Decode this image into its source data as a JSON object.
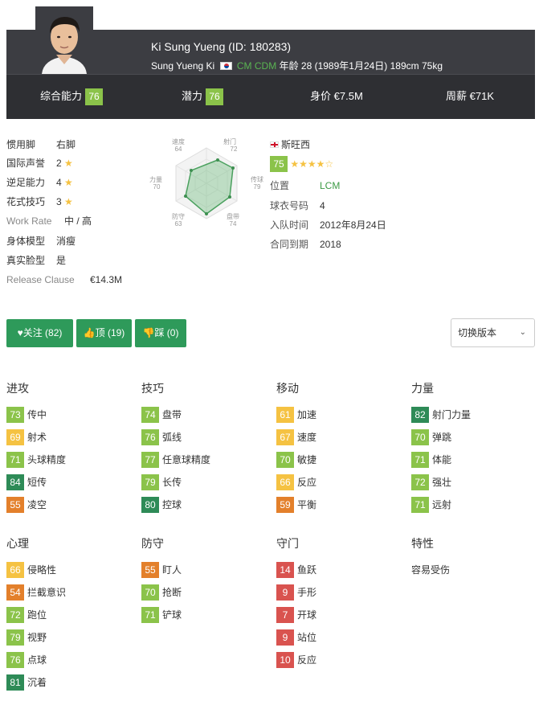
{
  "header": {
    "name": "Ki Sung Yueng (ID: 180283)",
    "short_name": "Sung Yueng Ki",
    "positions": [
      "CM",
      "CDM"
    ],
    "bio": "年龄 28 (1989年1月24日) 189cm 75kg",
    "overall_label": "综合能力",
    "overall_value": "76",
    "potential_label": "潜力",
    "potential_value": "76",
    "value_label": "身价",
    "value_value": "€7.5M",
    "wage_label": "周薪",
    "wage_value": "€71K"
  },
  "info": [
    {
      "label": "惯用脚",
      "value": "右脚"
    },
    {
      "label": "国际声誉",
      "value": "2",
      "star": "★"
    },
    {
      "label": "逆足能力",
      "value": "4",
      "star": "★"
    },
    {
      "label": "花式技巧",
      "value": "3",
      "star": "★"
    },
    {
      "label": "Work Rate",
      "value": "中 / 高"
    },
    {
      "label": "身体模型",
      "value": "消瘦"
    },
    {
      "label": "真实脸型",
      "value": "是"
    },
    {
      "label": "Release Clause",
      "value": "€14.3M"
    }
  ],
  "radar": {
    "labels": [
      {
        "name": "射门",
        "value": "72"
      },
      {
        "name": "传球",
        "value": "79"
      },
      {
        "name": "盘带",
        "value": "74"
      },
      {
        "name": "防守",
        "value": "63"
      },
      {
        "name": "力量",
        "value": "70"
      },
      {
        "name": "速度",
        "value": "64"
      }
    ]
  },
  "club": {
    "name": "斯旺西",
    "rating": "75",
    "stars": "★★★★☆",
    "rows": [
      {
        "label": "位置",
        "value": "LCM"
      },
      {
        "label": "球衣号码",
        "value": "4"
      },
      {
        "label": "入队时间",
        "value": "2012年8月24日"
      },
      {
        "label": "合同到期",
        "value": "2018"
      }
    ]
  },
  "actions": {
    "follow": "关注 (82)",
    "like": "顶 (19)",
    "dislike": "踩 (0)",
    "version_select": "切换版本"
  },
  "groups": [
    {
      "title": "进攻",
      "attrs": [
        {
          "v": "73",
          "n": "传中"
        },
        {
          "v": "69",
          "n": "射术"
        },
        {
          "v": "71",
          "n": "头球精度"
        },
        {
          "v": "84",
          "n": "短传"
        },
        {
          "v": "55",
          "n": "凌空"
        }
      ]
    },
    {
      "title": "技巧",
      "attrs": [
        {
          "v": "74",
          "n": "盘带"
        },
        {
          "v": "76",
          "n": "弧线"
        },
        {
          "v": "77",
          "n": "任意球精度"
        },
        {
          "v": "79",
          "n": "长传"
        },
        {
          "v": "80",
          "n": "控球"
        }
      ]
    },
    {
      "title": "移动",
      "attrs": [
        {
          "v": "61",
          "n": "加速"
        },
        {
          "v": "67",
          "n": "速度"
        },
        {
          "v": "70",
          "n": "敏捷"
        },
        {
          "v": "66",
          "n": "反应"
        },
        {
          "v": "59",
          "n": "平衡"
        }
      ]
    },
    {
      "title": "力量",
      "attrs": [
        {
          "v": "82",
          "n": "射门力量"
        },
        {
          "v": "70",
          "n": "弹跳"
        },
        {
          "v": "71",
          "n": "体能"
        },
        {
          "v": "72",
          "n": "强壮"
        },
        {
          "v": "71",
          "n": "远射"
        }
      ]
    },
    {
      "title": "心理",
      "attrs": [
        {
          "v": "66",
          "n": "侵略性"
        },
        {
          "v": "54",
          "n": "拦截意识"
        },
        {
          "v": "72",
          "n": "跑位"
        },
        {
          "v": "79",
          "n": "视野"
        },
        {
          "v": "76",
          "n": "点球"
        },
        {
          "v": "81",
          "n": "沉着"
        }
      ]
    },
    {
      "title": "防守",
      "attrs": [
        {
          "v": "55",
          "n": "盯人"
        },
        {
          "v": "70",
          "n": "抢断"
        },
        {
          "v": "71",
          "n": "铲球"
        }
      ]
    },
    {
      "title": "守门",
      "attrs": [
        {
          "v": "14",
          "n": "鱼跃"
        },
        {
          "v": "9",
          "n": "手形"
        },
        {
          "v": "7",
          "n": "开球"
        },
        {
          "v": "9",
          "n": "站位"
        },
        {
          "v": "10",
          "n": "反应"
        }
      ]
    },
    {
      "title": "特性",
      "traits": [
        "容易受伤"
      ]
    }
  ]
}
